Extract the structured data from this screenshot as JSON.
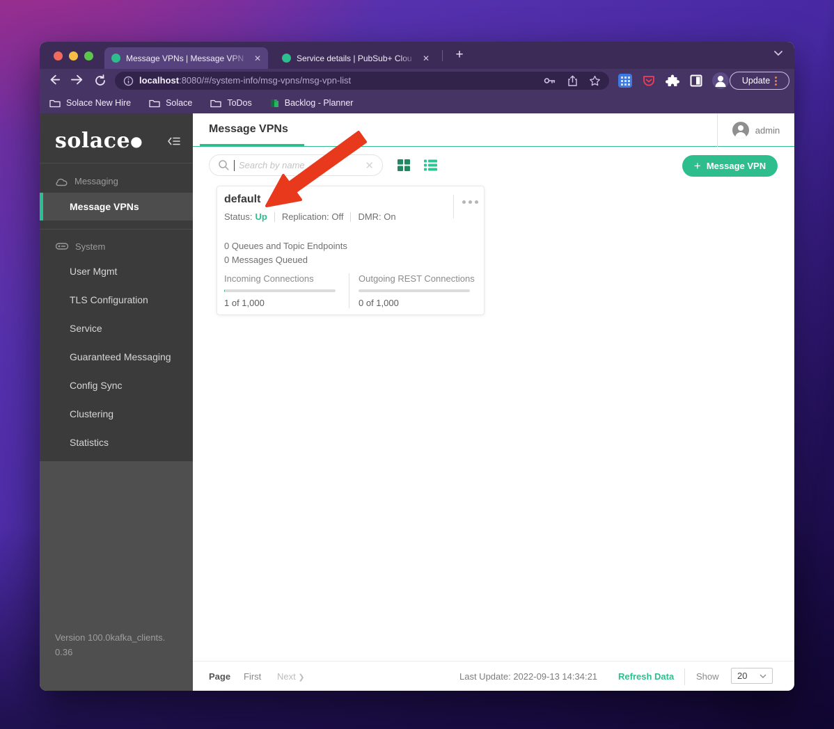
{
  "colors": {
    "accent": "#2ebd8d",
    "arrow": "#e8391d",
    "tabstrip": "#3c2b57",
    "toolbar": "#463464"
  },
  "browser": {
    "tabs": [
      {
        "title": "Message VPNs | Message VPN",
        "close": "✕"
      },
      {
        "title": "Service details | PubSub+ Clou",
        "close": "✕"
      }
    ],
    "new_tab_label": "+",
    "address": {
      "host": "localhost",
      "path": ":8080/#/system-info/msg-vpns/msg-vpn-list"
    },
    "update_button": "Update",
    "bookmarks": [
      "Solace New Hire",
      "Solace",
      "ToDos",
      "Backlog - Planner"
    ]
  },
  "sidebar": {
    "logo": "solace",
    "logo_dot": "●",
    "messaging": {
      "label": "Messaging",
      "selected_item": "Message VPNs"
    },
    "system": {
      "label": "System",
      "items": [
        "User Mgmt",
        "TLS Configuration",
        "Service",
        "Guaranteed Messaging",
        "Config Sync",
        "Clustering",
        "Statistics"
      ]
    },
    "version_line1": "Version 100.0kafka_clients.",
    "version_line2": "0.36"
  },
  "header": {
    "title": "Message VPNs",
    "user": "admin"
  },
  "toolbar": {
    "search_placeholder": "Search by name",
    "create_plus": "+",
    "create_label": "Message VPN"
  },
  "card": {
    "name": "default",
    "status_label": "Status:",
    "status_value": "Up",
    "replication": "Replication: Off",
    "dmr": "DMR: On",
    "queues_line": "0 Queues and Topic Endpoints",
    "messages_line": "0 Messages Queued",
    "metrics": [
      {
        "label": "Incoming Connections",
        "value": "1 of 1,000",
        "percent": 0.1
      },
      {
        "label": "Outgoing REST Connections",
        "value": "0 of 1,000",
        "percent": 0
      }
    ]
  },
  "footer": {
    "page_label": "Page",
    "first": "First",
    "next": "Next",
    "last_update": "Last Update: 2022-09-13 14:34:21",
    "refresh": "Refresh Data",
    "show_label": "Show",
    "page_size": "20"
  }
}
